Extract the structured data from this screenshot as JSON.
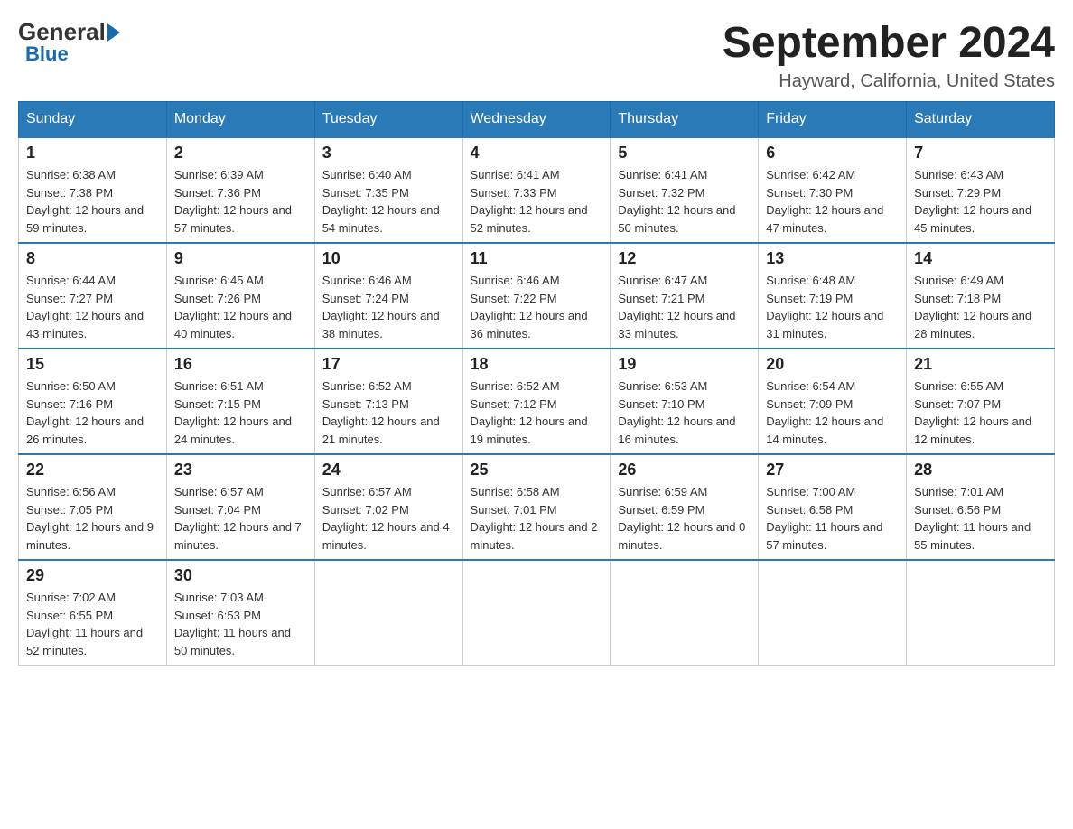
{
  "header": {
    "logo_general": "General",
    "logo_blue": "Blue",
    "month_title": "September 2024",
    "location": "Hayward, California, United States"
  },
  "days_of_week": [
    "Sunday",
    "Monday",
    "Tuesday",
    "Wednesday",
    "Thursday",
    "Friday",
    "Saturday"
  ],
  "weeks": [
    [
      {
        "day": "1",
        "sunrise": "6:38 AM",
        "sunset": "7:38 PM",
        "daylight": "12 hours and 59 minutes."
      },
      {
        "day": "2",
        "sunrise": "6:39 AM",
        "sunset": "7:36 PM",
        "daylight": "12 hours and 57 minutes."
      },
      {
        "day": "3",
        "sunrise": "6:40 AM",
        "sunset": "7:35 PM",
        "daylight": "12 hours and 54 minutes."
      },
      {
        "day": "4",
        "sunrise": "6:41 AM",
        "sunset": "7:33 PM",
        "daylight": "12 hours and 52 minutes."
      },
      {
        "day": "5",
        "sunrise": "6:41 AM",
        "sunset": "7:32 PM",
        "daylight": "12 hours and 50 minutes."
      },
      {
        "day": "6",
        "sunrise": "6:42 AM",
        "sunset": "7:30 PM",
        "daylight": "12 hours and 47 minutes."
      },
      {
        "day": "7",
        "sunrise": "6:43 AM",
        "sunset": "7:29 PM",
        "daylight": "12 hours and 45 minutes."
      }
    ],
    [
      {
        "day": "8",
        "sunrise": "6:44 AM",
        "sunset": "7:27 PM",
        "daylight": "12 hours and 43 minutes."
      },
      {
        "day": "9",
        "sunrise": "6:45 AM",
        "sunset": "7:26 PM",
        "daylight": "12 hours and 40 minutes."
      },
      {
        "day": "10",
        "sunrise": "6:46 AM",
        "sunset": "7:24 PM",
        "daylight": "12 hours and 38 minutes."
      },
      {
        "day": "11",
        "sunrise": "6:46 AM",
        "sunset": "7:22 PM",
        "daylight": "12 hours and 36 minutes."
      },
      {
        "day": "12",
        "sunrise": "6:47 AM",
        "sunset": "7:21 PM",
        "daylight": "12 hours and 33 minutes."
      },
      {
        "day": "13",
        "sunrise": "6:48 AM",
        "sunset": "7:19 PM",
        "daylight": "12 hours and 31 minutes."
      },
      {
        "day": "14",
        "sunrise": "6:49 AM",
        "sunset": "7:18 PM",
        "daylight": "12 hours and 28 minutes."
      }
    ],
    [
      {
        "day": "15",
        "sunrise": "6:50 AM",
        "sunset": "7:16 PM",
        "daylight": "12 hours and 26 minutes."
      },
      {
        "day": "16",
        "sunrise": "6:51 AM",
        "sunset": "7:15 PM",
        "daylight": "12 hours and 24 minutes."
      },
      {
        "day": "17",
        "sunrise": "6:52 AM",
        "sunset": "7:13 PM",
        "daylight": "12 hours and 21 minutes."
      },
      {
        "day": "18",
        "sunrise": "6:52 AM",
        "sunset": "7:12 PM",
        "daylight": "12 hours and 19 minutes."
      },
      {
        "day": "19",
        "sunrise": "6:53 AM",
        "sunset": "7:10 PM",
        "daylight": "12 hours and 16 minutes."
      },
      {
        "day": "20",
        "sunrise": "6:54 AM",
        "sunset": "7:09 PM",
        "daylight": "12 hours and 14 minutes."
      },
      {
        "day": "21",
        "sunrise": "6:55 AM",
        "sunset": "7:07 PM",
        "daylight": "12 hours and 12 minutes."
      }
    ],
    [
      {
        "day": "22",
        "sunrise": "6:56 AM",
        "sunset": "7:05 PM",
        "daylight": "12 hours and 9 minutes."
      },
      {
        "day": "23",
        "sunrise": "6:57 AM",
        "sunset": "7:04 PM",
        "daylight": "12 hours and 7 minutes."
      },
      {
        "day": "24",
        "sunrise": "6:57 AM",
        "sunset": "7:02 PM",
        "daylight": "12 hours and 4 minutes."
      },
      {
        "day": "25",
        "sunrise": "6:58 AM",
        "sunset": "7:01 PM",
        "daylight": "12 hours and 2 minutes."
      },
      {
        "day": "26",
        "sunrise": "6:59 AM",
        "sunset": "6:59 PM",
        "daylight": "12 hours and 0 minutes."
      },
      {
        "day": "27",
        "sunrise": "7:00 AM",
        "sunset": "6:58 PM",
        "daylight": "11 hours and 57 minutes."
      },
      {
        "day": "28",
        "sunrise": "7:01 AM",
        "sunset": "6:56 PM",
        "daylight": "11 hours and 55 minutes."
      }
    ],
    [
      {
        "day": "29",
        "sunrise": "7:02 AM",
        "sunset": "6:55 PM",
        "daylight": "11 hours and 52 minutes."
      },
      {
        "day": "30",
        "sunrise": "7:03 AM",
        "sunset": "6:53 PM",
        "daylight": "11 hours and 50 minutes."
      },
      null,
      null,
      null,
      null,
      null
    ]
  ]
}
